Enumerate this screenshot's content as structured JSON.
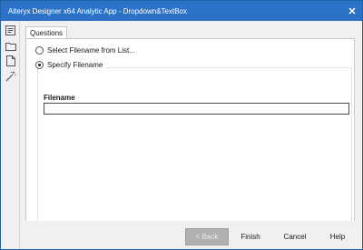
{
  "window": {
    "title": "Alteryx Designer x64 Analytic App - Dropdown&TextBox",
    "close_glyph": "✕"
  },
  "leftbar": {
    "icons": [
      "questions-icon",
      "open-folder-icon",
      "document-icon",
      "wand-icon"
    ]
  },
  "tabs": [
    {
      "label": "Questions",
      "active": true
    }
  ],
  "questions": {
    "option_list_label": "Select Filename from List...",
    "option_list_selected": false,
    "option_specify_label": "Specify Filename",
    "option_specify_selected": true,
    "filename_label": "Filename",
    "filename_value": ""
  },
  "footer": {
    "back_label": "< Back",
    "back_enabled": false,
    "finish_label": "Finish",
    "cancel_label": "Cancel",
    "help_label": "Help"
  },
  "colors": {
    "titlebar": "#2c72c7",
    "window_bg": "#f0f0f0",
    "disabled_button": "#b0b0b0"
  }
}
